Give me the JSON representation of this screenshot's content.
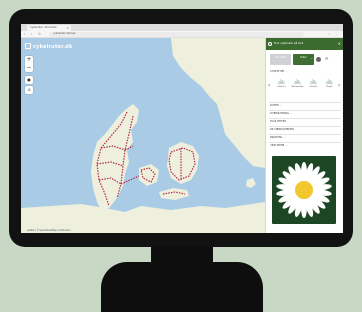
{
  "browser": {
    "tab_title": "Cykelruter i Danmark",
    "tab_close": "×",
    "nav_back": "‹",
    "nav_forward": "›",
    "nav_reload": "↻",
    "url": "cykelruter.dk/map",
    "menu_icons": "☆ ⋮"
  },
  "map": {
    "brand": "cykelruter.dk",
    "zoom_in": "+",
    "zoom_out": "−",
    "locate": "●",
    "layers": "⊙",
    "attribution": "Leaflet | © OpenStreetMap contributors",
    "colors": {
      "sea": "#a9cbe6",
      "land": "#eef0dd",
      "route": "#b22a4a"
    }
  },
  "panel": {
    "header": "Find cykelruter på kort",
    "close": "×",
    "selector_left": "Alle ruter",
    "selector_right": "Ruter",
    "cycle_section": "CYKELTYPE",
    "cycle_types": [
      {
        "icon": "bike-icon",
        "glyph": "🚲",
        "label": "Landevej"
      },
      {
        "icon": "bike-icon",
        "glyph": "🚲",
        "label": "Mountainbike"
      },
      {
        "icon": "bike-icon",
        "glyph": "🚲",
        "label": "Ladcykel"
      },
      {
        "icon": "bike-icon",
        "glyph": "🚲",
        "label": "Elcykel"
      }
    ],
    "sections": [
      "RUTER",
      "OVERNATNING",
      "FACILITETER",
      "SE-VÆRDIGHEDER",
      "PRAKTISK",
      "VIDE MERE"
    ],
    "caret": "⌄",
    "card_colors": {
      "bg": "#1d4724",
      "petal": "#ffffff",
      "center": "#f2c72e"
    }
  }
}
